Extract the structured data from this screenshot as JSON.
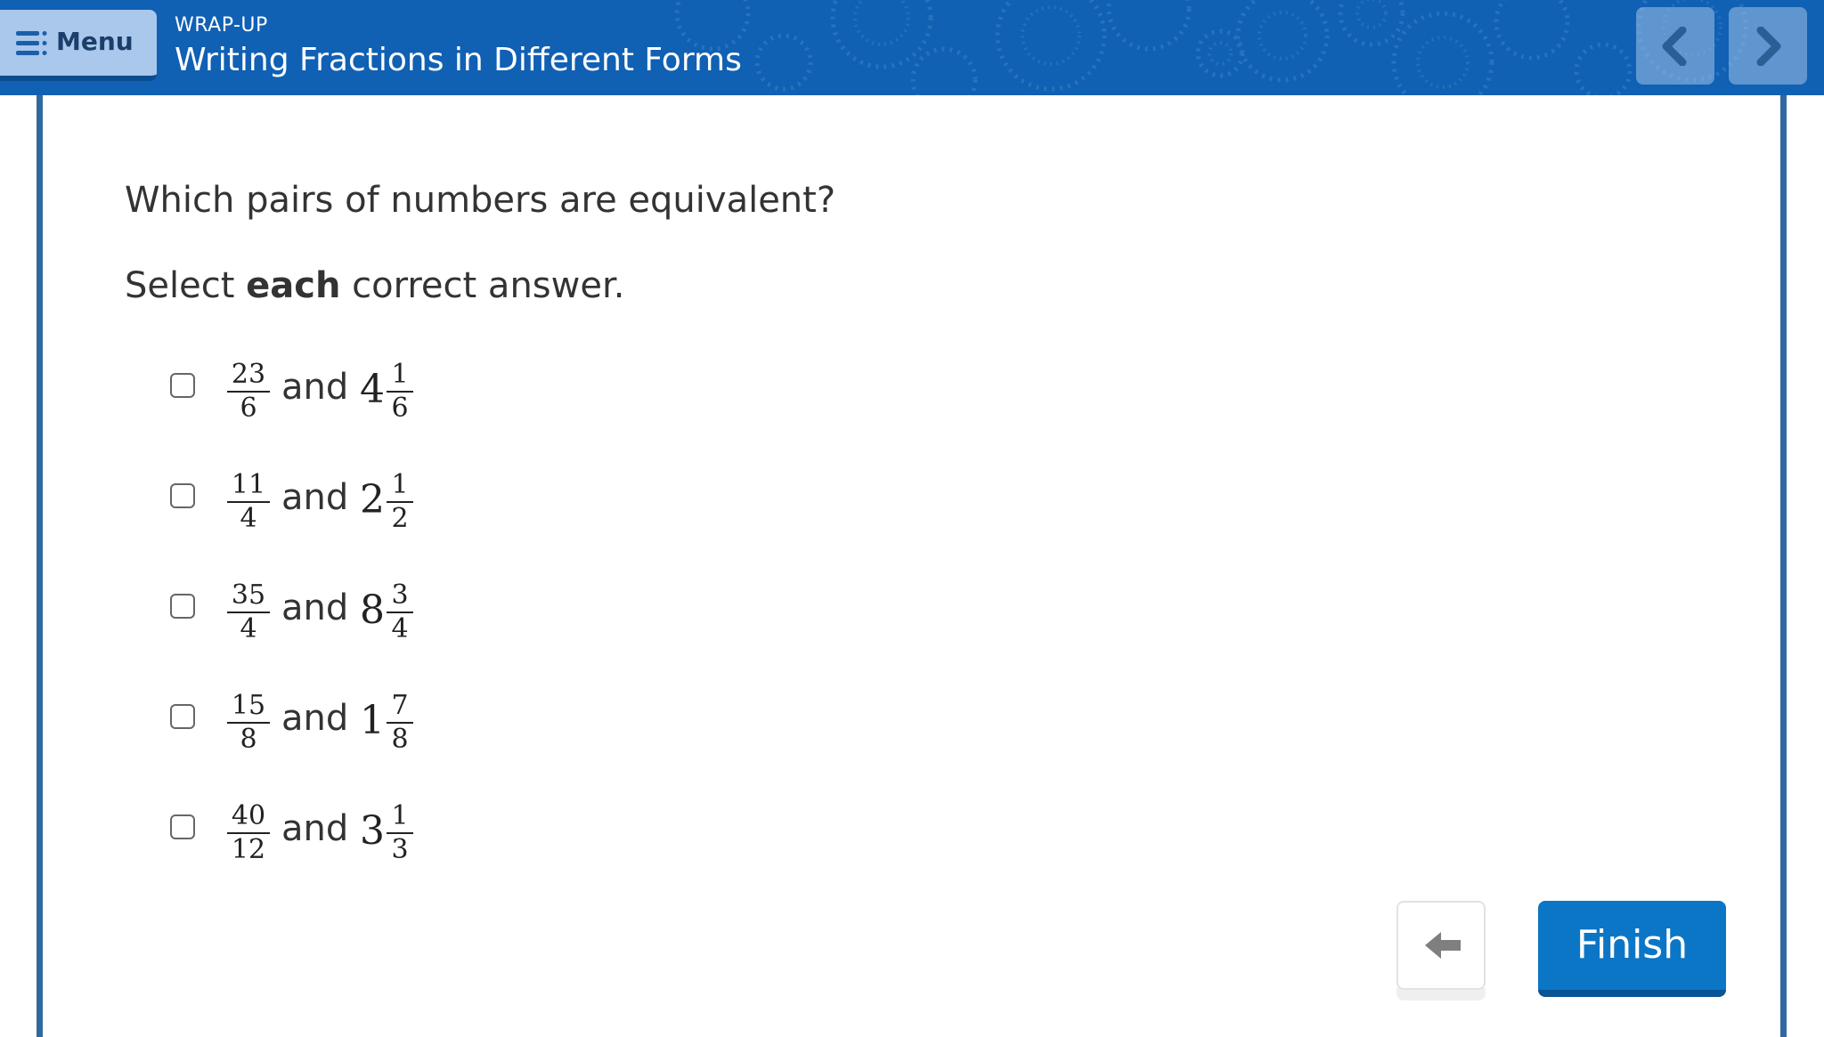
{
  "header": {
    "menu_label": "Menu",
    "menu_icon": "menu-icon",
    "section_label": "WRAP-UP",
    "lesson_title": "Writing Fractions in Different Forms",
    "prev_icon": "chevron-left-icon",
    "next_icon": "chevron-right-icon",
    "colors": {
      "header_bg": "#1060b4",
      "menu_bg": "#a9c8ec",
      "frame": "#2e6aa0"
    }
  },
  "question": {
    "prompt": "Which pairs of numbers are equivalent?",
    "instruction_prefix": "Select ",
    "instruction_bold": "each",
    "instruction_suffix": " correct answer.",
    "choices": [
      {
        "numerator": "23",
        "denominator": "6",
        "connector": "and",
        "whole": "4",
        "mixed_numerator": "1",
        "mixed_denominator": "6",
        "checked": false
      },
      {
        "numerator": "11",
        "denominator": "4",
        "connector": "and",
        "whole": "2",
        "mixed_numerator": "1",
        "mixed_denominator": "2",
        "checked": false
      },
      {
        "numerator": "35",
        "denominator": "4",
        "connector": "and",
        "whole": "8",
        "mixed_numerator": "3",
        "mixed_denominator": "4",
        "checked": false
      },
      {
        "numerator": "15",
        "denominator": "8",
        "connector": "and",
        "whole": "1",
        "mixed_numerator": "7",
        "mixed_denominator": "8",
        "checked": false
      },
      {
        "numerator": "40",
        "denominator": "12",
        "connector": "and",
        "whole": "3",
        "mixed_numerator": "1",
        "mixed_denominator": "3",
        "checked": false
      }
    ]
  },
  "footer": {
    "back_icon": "arrow-left-icon",
    "finish_label": "Finish",
    "finish_color": "#0c76c6"
  }
}
